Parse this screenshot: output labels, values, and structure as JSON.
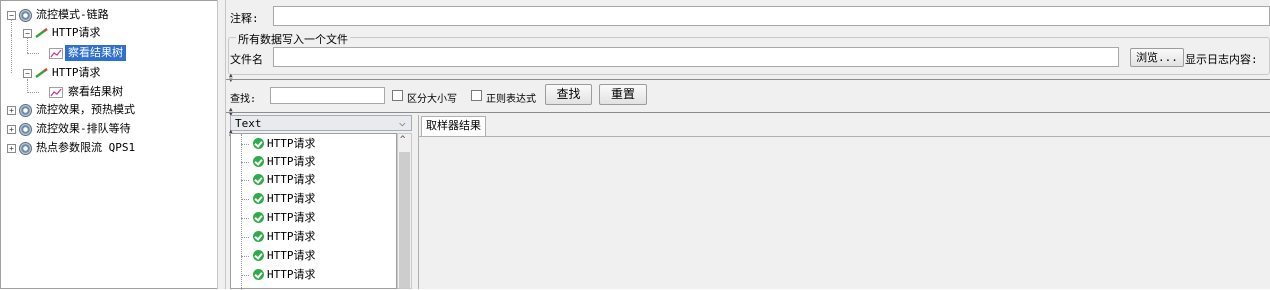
{
  "tree": {
    "nodes": [
      {
        "label": "流控模式-链路",
        "expander": "−",
        "icon": "gear-icon"
      },
      {
        "label": "HTTP请求",
        "expander": "−",
        "icon": "pencil-icon"
      },
      {
        "label": "察看结果树",
        "icon": "chart-icon",
        "selected": true
      },
      {
        "label": "HTTP请求",
        "expander": "−",
        "icon": "pencil-icon"
      },
      {
        "label": "察看结果树",
        "icon": "chart-icon"
      },
      {
        "label": "流控效果，预热模式",
        "expander": "+",
        "icon": "gear-icon"
      },
      {
        "label": "流控效果-排队等待",
        "expander": "+",
        "icon": "gear-icon"
      },
      {
        "label": "热点参数限流 QPS1",
        "expander": "+",
        "icon": "gear-icon"
      }
    ]
  },
  "form": {
    "comment_label": "注释:",
    "group_title": "所有数据写入一个文件",
    "filename_label": "文件名",
    "browse_label": "浏览...",
    "log_label": "显示日志内容:"
  },
  "search": {
    "label": "查找:",
    "case_label": "区分大小写",
    "regex_label": "正则表达式",
    "find_label": "查找",
    "reset_label": "重置"
  },
  "results": {
    "renderer": "Text",
    "items": [
      "HTTP请求",
      "HTTP请求",
      "HTTP请求",
      "HTTP请求",
      "HTTP请求",
      "HTTP请求",
      "HTTP请求",
      "HTTP请求"
    ],
    "tab_label": "取样器结果"
  },
  "colors": {
    "selection": "#2f6fd0",
    "success": "#2eab4a"
  }
}
